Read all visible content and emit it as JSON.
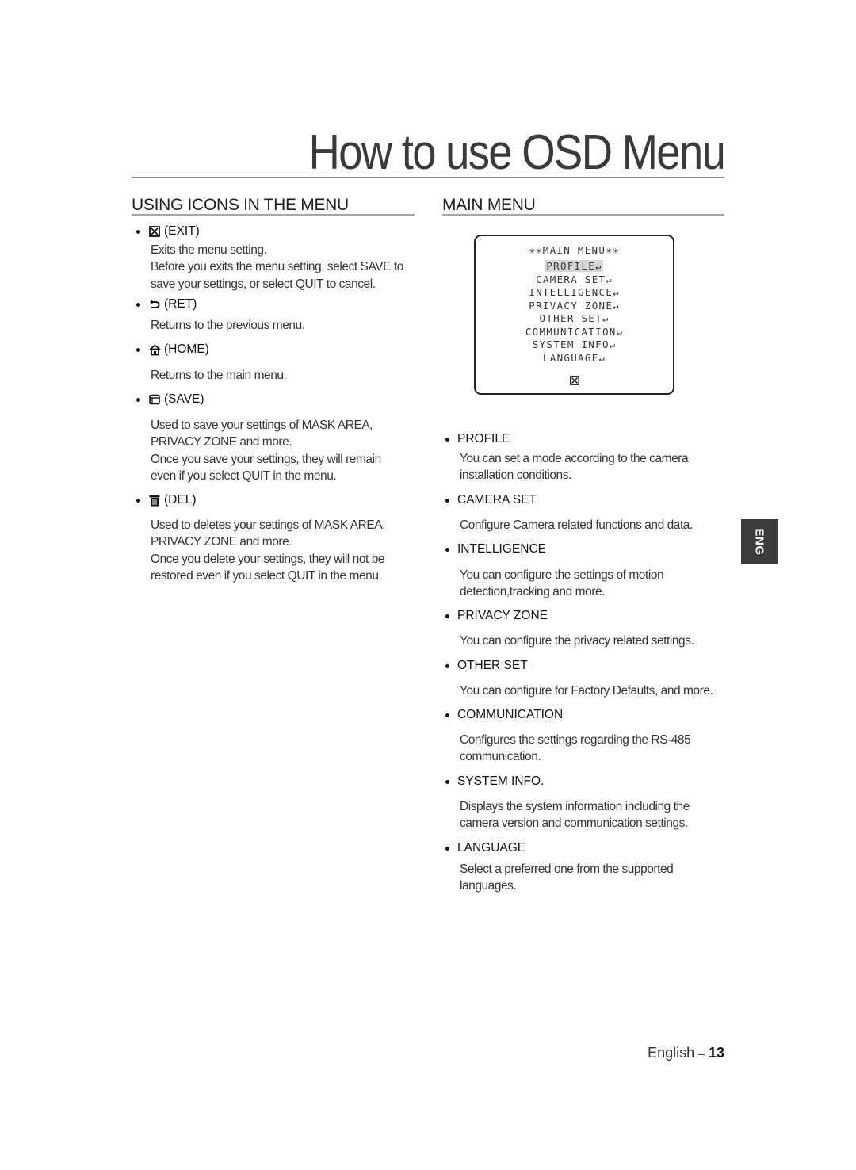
{
  "page": {
    "title": "How to use OSD Menu",
    "side_tab": "ENG",
    "footer_label": "English",
    "footer_sep": "–",
    "page_number": "13"
  },
  "icons_section": {
    "heading": "USING ICONS IN THE MENU",
    "items": [
      {
        "icon": "exit-icon",
        "label": "(EXIT)",
        "lines": [
          "Exits the menu setting.",
          "Before you exits the menu setting, select SAVE to",
          "save your settings, or select QUIT to cancel."
        ]
      },
      {
        "icon": "return-icon",
        "label": "(RET)",
        "lines": [
          "Returns to the previous menu."
        ]
      },
      {
        "icon": "home-icon",
        "label": "(HOME)",
        "lines": [
          "Returns to the main menu."
        ]
      },
      {
        "icon": "save-icon",
        "label": "(SAVE)",
        "lines": [
          "Used to save your settings of MASK AREA,",
          "PRIVACY ZONE and more.",
          "Once you save your settings, they will remain",
          "even if you select QUIT in the menu."
        ]
      },
      {
        "icon": "delete-icon",
        "label": "(DEL)",
        "lines": [
          "Used to deletes your settings of MASK AREA,",
          "PRIVACY ZONE and more.",
          "Once you delete your settings, they will not be",
          "restored even if you select QUIT in the menu."
        ]
      }
    ]
  },
  "main_menu_section": {
    "heading": "MAIN MENU",
    "osd": {
      "title": "✳✳MAIN MENU✳✳",
      "selected": "PROFILE",
      "enter_glyph": "↵",
      "items": [
        "PROFILE",
        "CAMERA SET",
        "INTELLIGENCE",
        "PRIVACY ZONE",
        "OTHER SET",
        "COMMUNICATION",
        "SYSTEM INFO",
        "LANGUAGE"
      ],
      "exit_glyph": "⊠"
    },
    "items": [
      {
        "label": "PROFILE",
        "lines": [
          "You can set a mode according to the camera",
          "installation conditions."
        ]
      },
      {
        "label": "CAMERA SET",
        "lines": [
          "Configure Camera related functions and data."
        ]
      },
      {
        "label": "INTELLIGENCE",
        "lines": [
          "You can configure the settings of motion",
          "detection,tracking and more."
        ]
      },
      {
        "label": "PRIVACY ZONE",
        "lines": [
          "You can configure the privacy related settings."
        ]
      },
      {
        "label": "OTHER SET",
        "lines": [
          "You can configure for Factory Defaults, and more."
        ]
      },
      {
        "label": "COMMUNICATION",
        "lines": [
          "Configures the settings regarding the RS-485",
          "communication."
        ]
      },
      {
        "label": "SYSTEM INFO.",
        "lines": [
          "Displays the system information including the",
          "camera version and communication settings."
        ]
      },
      {
        "label": "LANGUAGE",
        "lines": [
          "Select a preferred one from the supported",
          "languages."
        ]
      }
    ]
  }
}
